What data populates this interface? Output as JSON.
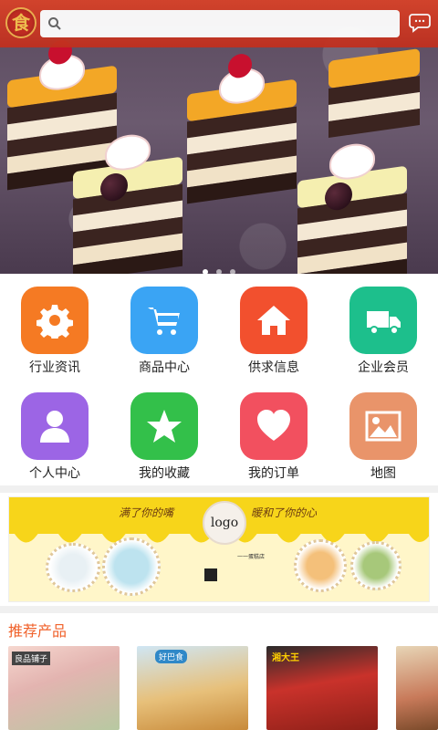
{
  "header": {
    "logo_char": "食",
    "search": {
      "placeholder": "",
      "value": ""
    }
  },
  "carousel": {
    "dots": 3,
    "active_index": 0
  },
  "grid": [
    {
      "label": "行业资讯",
      "icon": "gear-icon",
      "color": "#f57a23"
    },
    {
      "label": "商品中心",
      "icon": "cart-icon",
      "color": "#3aa4f4"
    },
    {
      "label": "供求信息",
      "icon": "home-icon",
      "color": "#f2502e"
    },
    {
      "label": "企业会员",
      "icon": "truck-icon",
      "color": "#1dbf8c"
    },
    {
      "label": "个人中心",
      "icon": "user-icon",
      "color": "#9c65e5"
    },
    {
      "label": "我的收藏",
      "icon": "star-icon",
      "color": "#33c04a"
    },
    {
      "label": "我的订单",
      "icon": "heart-icon",
      "color": "#f2505f"
    },
    {
      "label": "地图",
      "icon": "image-icon",
      "color": "#e9946a"
    }
  ],
  "promo": {
    "logo": "logo",
    "slogan_left": "满了你的嘴",
    "slogan_right": "暖和了你的心",
    "shop_name": "一一蛋糕店"
  },
  "recommend": {
    "title": "推荐产品",
    "items": [
      {
        "brand": "良品铺子",
        "color": "#e3b4b0"
      },
      {
        "brand": "好巴食",
        "color": "#e7c07a"
      },
      {
        "brand": "湘大王",
        "color": "#c9322b"
      },
      {
        "brand": "",
        "color": "#e7d5b6"
      }
    ]
  }
}
